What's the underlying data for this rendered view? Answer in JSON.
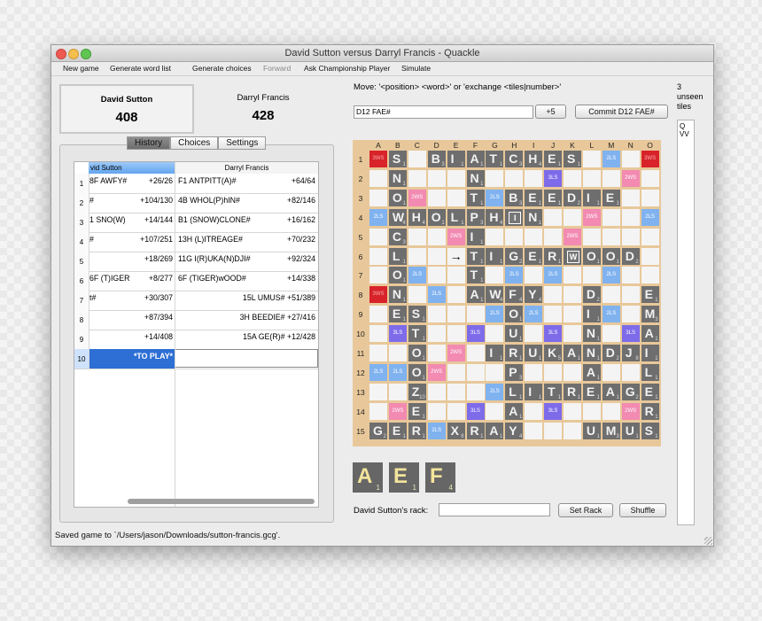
{
  "window": {
    "title": "David Sutton versus Darryl Francis - Quackle"
  },
  "menu": [
    {
      "label": "New game",
      "enabled": true
    },
    {
      "label": "Generate word list",
      "enabled": true
    },
    {
      "label": "Generate choices",
      "enabled": true
    },
    {
      "label": "Forward",
      "enabled": false
    },
    {
      "label": "Ask Championship Player",
      "enabled": true
    },
    {
      "label": "Simulate",
      "enabled": true
    }
  ],
  "players": [
    {
      "name": "David Sutton",
      "score": "408"
    },
    {
      "name": "Darryl Francis",
      "score": "428"
    }
  ],
  "tabs": [
    {
      "label": "History",
      "active": true
    },
    {
      "label": "Choices",
      "active": false
    },
    {
      "label": "Settings",
      "active": false
    }
  ],
  "history": {
    "headers": [
      "vid Sutton",
      "Darryl Francis"
    ],
    "rows": [
      {
        "n": "1",
        "p1_move": "8F AWFY#",
        "p1_score": "+26/26",
        "p2_move": "F1 ANTPITT(A)#",
        "p2_score": "+64/64"
      },
      {
        "n": "2",
        "p1_move": "#",
        "p1_score": "+104/130",
        "p2_move": "4B WHOL(P)hIN#",
        "p2_score": "+82/146"
      },
      {
        "n": "3",
        "p1_move": "1 SNO(W)",
        "p1_score": "+14/144",
        "p2_move": "B1 (SNOW)CLONE#",
        "p2_score": "+16/162"
      },
      {
        "n": "4",
        "p1_move": "#",
        "p1_score": "+107/251",
        "p2_move": "13H (L)ITREAGE#",
        "p2_score": "+70/232"
      },
      {
        "n": "5",
        "p1_move": "",
        "p1_score": "+18/269",
        "p2_move": "11G I(R)UKA(N)DJI#",
        "p2_score": "+92/324"
      },
      {
        "n": "6",
        "p1_move": "6F (T)IGER",
        "p1_score": "+8/277",
        "p2_move": "6F (TIGER)wOOD#",
        "p2_score": "+14/338"
      },
      {
        "n": "7",
        "p1_move": "t#",
        "p1_score": "+30/307",
        "p2_move": "",
        "p2_score": "15L UMUS# +51/389"
      },
      {
        "n": "8",
        "p1_move": "",
        "p1_score": "+87/394",
        "p2_move": "",
        "p2_score": "3H BEEDIE# +27/416"
      },
      {
        "n": "9",
        "p1_move": "",
        "p1_score": "+14/408",
        "p2_move": "",
        "p2_score": "15A GE(R)# +12/428"
      },
      {
        "n": "10",
        "p1_move": "",
        "p1_score": "*TO PLAY*",
        "p2_move": "",
        "p2_score": ""
      }
    ]
  },
  "move": {
    "instructions": "Move: '<position> <word>' or 'exchange <tiles|number>'",
    "input_value": "D12 FAE#",
    "score_button": "+5",
    "commit_button": "Commit D12 FAE#"
  },
  "unseen": {
    "label_lines": [
      "3",
      "unseen",
      "tiles"
    ],
    "tiles": [
      "Q",
      "VV"
    ]
  },
  "board": {
    "columns": [
      "A",
      "B",
      "C",
      "D",
      "E",
      "F",
      "G",
      "H",
      "I",
      "J",
      "K",
      "L",
      "M",
      "N",
      "O"
    ],
    "rows": [
      "1",
      "2",
      "3",
      "4",
      "5",
      "6",
      "7",
      "8",
      "9",
      "10",
      "11",
      "12",
      "13",
      "14",
      "15"
    ],
    "grid": [
      "3W S  . B I A T C H E S . 2L . 3W",
      ". N . . . N . . . 3L . . . 2W .",
      ". O 2W . . T 2L B E E D I E . .",
      "2L W H O L P H I N . . 2W . . 2L",
      ". C . . 2W I . . . . 2W . . . .",
      ". L . . . T I G E R W O O D .",
      ". O 2L . . T . 2L . 2L . . 2L . .",
      "3W N . 2L . A W F Y . . D . . E",
      ". E S . . . 2L O 2L . . I 2L . M",
      ". 3L T . . 3L . U . 3L . N . 3L A",
      ". . O . 2W . I R U K A N D J I",
      "2L 2L O 2W . . . P . . . A . . L",
      ". . Z . . . 2L L I T R E A G E",
      ". 2W E . . 3L . A . 3L . . . 2W R",
      "G E R 2L X R A Y . . . U M U S"
    ],
    "blanks": [
      "H4",
      "K6"
    ],
    "arrow_square": "E6",
    "tile_values": {
      "A": "1",
      "B": "3",
      "C": "3",
      "D": "2",
      "E": "1",
      "F": "4",
      "G": "2",
      "H": "4",
      "I": "1",
      "J": "8",
      "K": "5",
      "L": "1",
      "M": "3",
      "N": "1",
      "O": "1",
      "P": "3",
      "R": "1",
      "S": "1",
      "T": "1",
      "U": "1",
      "W": "4",
      "X": "8",
      "Y": "4",
      "Z": "10"
    },
    "colors": {
      "tile": "#6e6e6e",
      "tile_letter": "#f2f2f2",
      "empty": "#f4f4f4",
      "3W": "#d8232a",
      "2W": "#f28ab1",
      "3L": "#7d6bea",
      "2L": "#7fb2ef",
      "ruler": "#e8c89a"
    }
  },
  "rack": {
    "tiles": [
      {
        "letter": "A",
        "value": "1"
      },
      {
        "letter": "E",
        "value": "1"
      },
      {
        "letter": "F",
        "value": "4"
      }
    ],
    "label": "David Sutton's rack:",
    "set_button": "Set Rack",
    "shuffle_button": "Shuffle"
  },
  "status": "Saved game to `/Users/jason/Downloads/sutton-francis.gcg'."
}
